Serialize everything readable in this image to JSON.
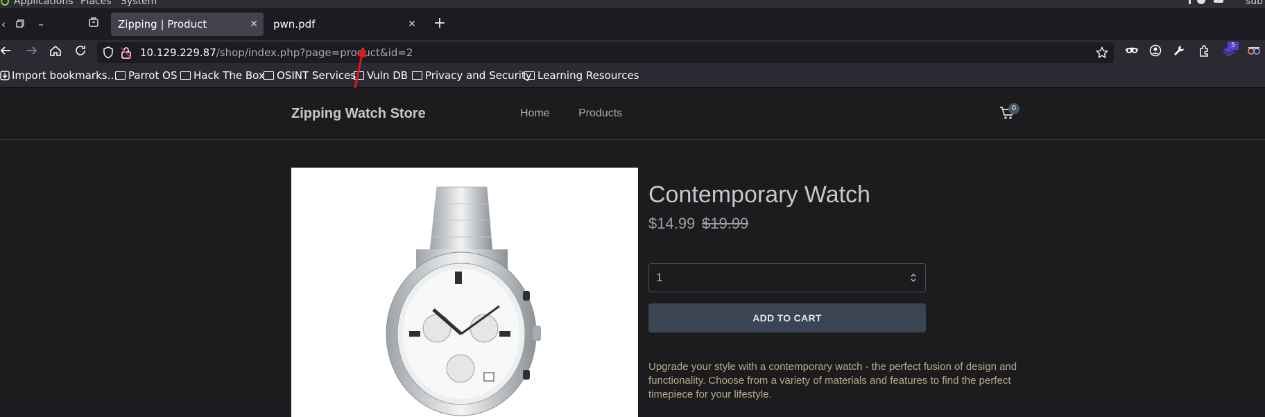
{
  "system_bar": {
    "items": [
      "Applications",
      "Places",
      "System"
    ],
    "right_text": "sub"
  },
  "tabs": [
    {
      "label": "Zipping | Product",
      "active": true
    },
    {
      "label": "pwn.pdf",
      "active": false
    }
  ],
  "address_bar": {
    "host": "10.129.229.87",
    "path": "/shop/index.php?page=product&id=2"
  },
  "extensions": {
    "badge_count": "5"
  },
  "bookmarks": [
    {
      "label": "Import bookmarks…",
      "type": "import"
    },
    {
      "label": "Parrot OS",
      "type": "folder"
    },
    {
      "label": "Hack The Box",
      "type": "folder"
    },
    {
      "label": "OSINT Services",
      "type": "folder"
    },
    {
      "label": "Vuln DB",
      "type": "folder"
    },
    {
      "label": "Privacy and Security",
      "type": "folder"
    },
    {
      "label": "Learning Resources",
      "type": "folder"
    }
  ],
  "site": {
    "brand": "Zipping Watch Store",
    "nav": [
      "Home",
      "Products"
    ],
    "cart_count": "0"
  },
  "product": {
    "title": "Contemporary Watch",
    "price": "$14.99",
    "old_price": "$19.99",
    "quantity": "1",
    "add_to_cart_label": "ADD TO CART",
    "description": "Upgrade your style with a contemporary watch - the perfect fusion of design and functionality. Choose from a variety of materials and features to find the perfect timepiece for your lifestyle."
  },
  "colors": {
    "accent_annotation": "#e0171b",
    "button_bg": "#3b4452",
    "page_bg": "#1c1c1e"
  }
}
